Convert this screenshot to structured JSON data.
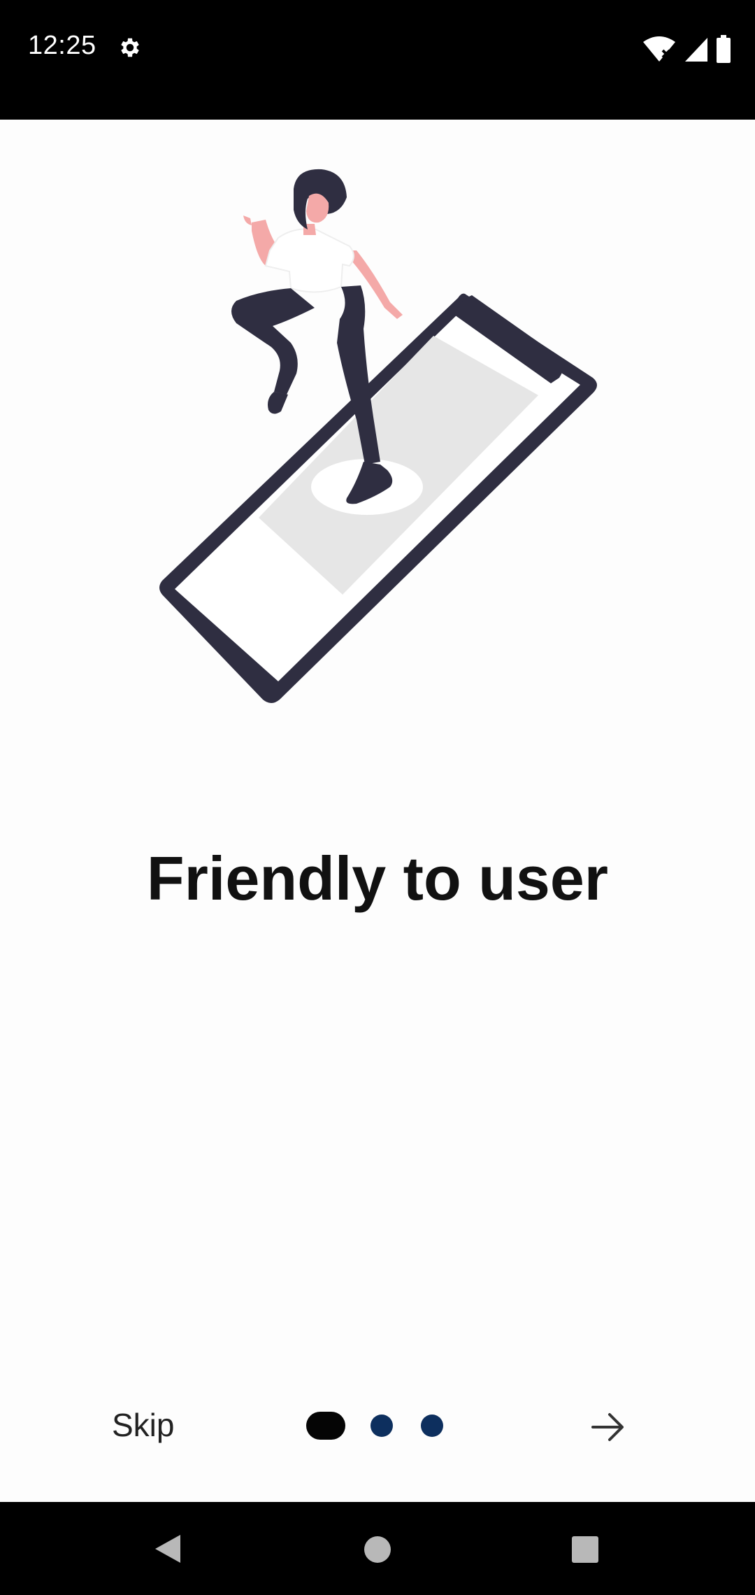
{
  "status_bar": {
    "time": "12:25",
    "icons": [
      "settings-gear-icon",
      "wifi-off-icon",
      "signal-icon",
      "battery-icon"
    ]
  },
  "onboarding": {
    "illustration": "woman-stepping-out-of-phone-illustration",
    "title": "Friendly to user",
    "skip_label": "Skip",
    "page_count": 3,
    "current_page": 1,
    "next_icon": "arrow-right-icon"
  },
  "colors": {
    "background": "#fdfdfd",
    "title_text": "#111111",
    "active_dot": "#050505",
    "inactive_dot": "#0d2f5e",
    "phone_frame": "#2f2e41",
    "skin": "#f4a9a8",
    "hair": "#2f2e41"
  },
  "navigation_bar": {
    "buttons": [
      "back-icon",
      "home-icon",
      "recents-icon"
    ]
  }
}
